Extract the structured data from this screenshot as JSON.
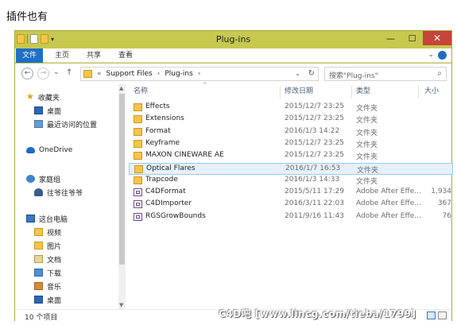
{
  "caption": "插件也有",
  "window": {
    "title": "Plug-ins",
    "min_glyph": "—",
    "max_glyph": "☐",
    "close_glyph": "✕"
  },
  "ribbon": {
    "tabs": [
      "文件",
      "主页",
      "共享",
      "查看"
    ],
    "expand_glyph": "⌄",
    "help_glyph": "?"
  },
  "address": {
    "back_glyph": "←",
    "forward_glyph": "→",
    "recent_glyph": "⌄",
    "up_glyph": "↑",
    "prefix": "«",
    "crumbs": [
      "Support Files",
      "Plug-ins"
    ],
    "separator": "›",
    "dropdown_glyph": "⌄",
    "refresh_glyph": "↻"
  },
  "search": {
    "placeholder": "搜索\"Plug-ins\"",
    "icon_glyph": "⌕"
  },
  "nav": {
    "items": [
      {
        "label": "收藏夹",
        "icon": "star-icon"
      },
      {
        "label": "桌面",
        "icon": "desktop-icon"
      },
      {
        "label": "最近访问的位置",
        "icon": "recent-places-icon"
      },
      {
        "label": "OneDrive",
        "icon": "cloud-icon"
      },
      {
        "label": "家庭组",
        "icon": "homegroup-icon"
      },
      {
        "label": "往爷往爷爷",
        "icon": "user-icon"
      },
      {
        "label": "这台电脑",
        "icon": "computer-icon"
      },
      {
        "label": "视频",
        "icon": "video-folder-icon"
      },
      {
        "label": "图片",
        "icon": "pictures-folder-icon"
      },
      {
        "label": "文档",
        "icon": "documents-folder-icon"
      },
      {
        "label": "下载",
        "icon": "downloads-folder-icon"
      },
      {
        "label": "音乐",
        "icon": "music-folder-icon"
      },
      {
        "label": "桌面",
        "icon": "desktop-folder-icon"
      }
    ]
  },
  "columns": {
    "name": "名称",
    "modified": "修改日期",
    "type": "类型",
    "size": "大小"
  },
  "files": [
    {
      "name": "Effects",
      "modified": "2015/12/7 23:25",
      "type": "文件夹",
      "size": "",
      "kind": "folder"
    },
    {
      "name": "Extensions",
      "modified": "2015/12/7 23:25",
      "type": "文件夹",
      "size": "",
      "kind": "folder"
    },
    {
      "name": "Format",
      "modified": "2016/1/3 14:22",
      "type": "文件夹",
      "size": "",
      "kind": "folder"
    },
    {
      "name": "Keyframe",
      "modified": "2015/12/7 23:25",
      "type": "文件夹",
      "size": "",
      "kind": "folder"
    },
    {
      "name": "MAXON CINEWARE AE",
      "modified": "2015/12/7 23:25",
      "type": "文件夹",
      "size": "",
      "kind": "folder"
    },
    {
      "name": "Optical Flares",
      "modified": "2016/1/7 16:53",
      "type": "文件夹",
      "size": "",
      "kind": "folder",
      "selected": true
    },
    {
      "name": "Trapcode",
      "modified": "2016/1/3 14:33",
      "type": "文件夹",
      "size": "",
      "kind": "folder"
    },
    {
      "name": "C4DFormat",
      "modified": "2015/5/11 17:29",
      "type": "Adobe After Effe...",
      "size": "1,934",
      "kind": "plugin"
    },
    {
      "name": "C4DImporter",
      "modified": "2016/3/11 22:03",
      "type": "Adobe After Effe...",
      "size": "367",
      "kind": "plugin"
    },
    {
      "name": "RGSGrowBounds",
      "modified": "2011/9/16 11:43",
      "type": "Adobe After Effe...",
      "size": "76",
      "kind": "plugin"
    }
  ],
  "status": {
    "count": "10 个项目"
  },
  "watermark": "C4D吧 [www.lincg.com/tieba/1799]"
}
